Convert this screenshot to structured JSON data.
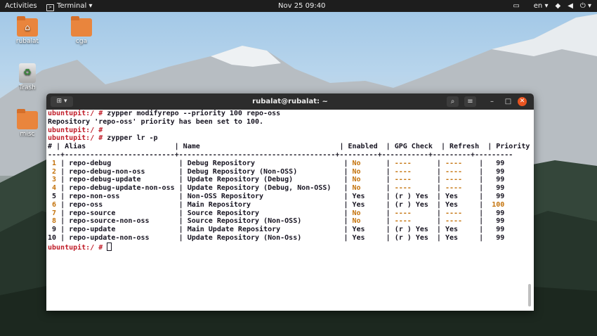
{
  "topbar": {
    "activities": "Activities",
    "app_name": "Terminal",
    "clock": "Nov 25  09:40",
    "language": "en"
  },
  "desktop_icons": [
    {
      "label": "rubalat",
      "icon": "home-folder-icon"
    },
    {
      "label": "cga",
      "icon": "folder-icon"
    },
    {
      "label": "Trash",
      "icon": "trash-icon"
    },
    {
      "label": "misc",
      "icon": "folder-icon"
    }
  ],
  "terminal": {
    "title": "rubalat@rubalat: ~",
    "prompt": "ubuntupit:/ # ",
    "commands": {
      "modify": "zypper modifyrepo --priority 100 repo-oss",
      "message": "Repository 'repo-oss' priority has been set to 100.",
      "list": "zypper lr -p"
    },
    "table": {
      "headers": [
        "#",
        "Alias",
        "Name",
        "Enabled",
        "GPG Check",
        "Refresh",
        "Priority"
      ],
      "separator": "---+--------------------------+-------------------------------------+---------+-----------+---------+---------",
      "rows": [
        [
          "1",
          "repo-debug",
          "Debug Repository",
          "No",
          "----",
          "----",
          "99"
        ],
        [
          "2",
          "repo-debug-non-oss",
          "Debug Repository (Non-OSS)",
          "No",
          "----",
          "----",
          "99"
        ],
        [
          "3",
          "repo-debug-update",
          "Update Repository (Debug)",
          "No",
          "----",
          "----",
          "99"
        ],
        [
          "4",
          "repo-debug-update-non-oss",
          "Update Repository (Debug, Non-OSS)",
          "No",
          "----",
          "----",
          "99"
        ],
        [
          "5",
          "repo-non-oss",
          "Non-OSS Repository",
          "Yes",
          "(r ) Yes",
          "Yes",
          "99"
        ],
        [
          "6",
          "repo-oss",
          "Main Repository",
          "Yes",
          "(r ) Yes",
          "Yes",
          "100"
        ],
        [
          "7",
          "repo-source",
          "Source Repository",
          "No",
          "----",
          "----",
          "99"
        ],
        [
          "8",
          "repo-source-non-oss",
          "Source Repository (Non-OSS)",
          "No",
          "----",
          "----",
          "99"
        ],
        [
          "9",
          "repo-update",
          "Main Update Repository",
          "Yes",
          "(r ) Yes",
          "Yes",
          "99"
        ],
        [
          "10",
          "repo-update-non-oss",
          "Update Repository (Non-Oss)",
          "Yes",
          "(r ) Yes",
          "Yes",
          "99"
        ]
      ]
    }
  },
  "colors": {
    "prompt": "#c01c28",
    "highlight": "#c4730c",
    "accent_close": "#e95420"
  }
}
